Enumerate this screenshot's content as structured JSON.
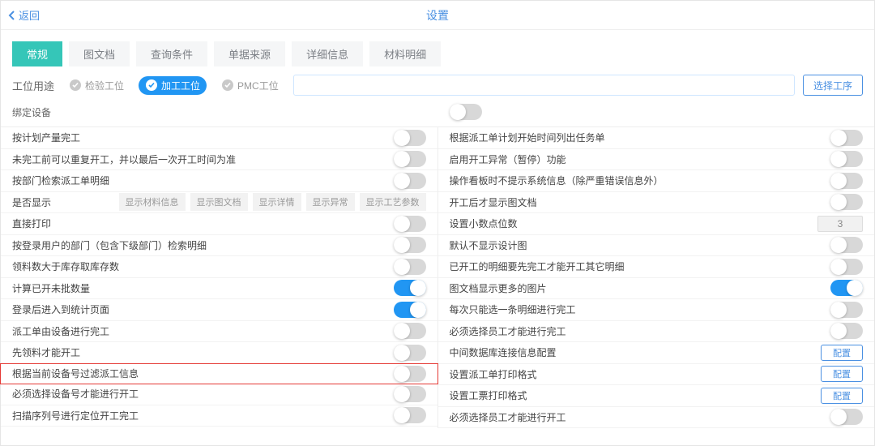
{
  "header": {
    "back": "返回",
    "title": "设置"
  },
  "tabs": [
    "常规",
    "图文档",
    "查询条件",
    "单据来源",
    "详细信息",
    "材料明细"
  ],
  "usage": {
    "label": "工位用途",
    "options": [
      "检验工位",
      "加工工位",
      "PMC工位"
    ],
    "select_process_btn": "选择工序"
  },
  "bind": {
    "label": "绑定设备"
  },
  "btns": {
    "show_material": "显示材料信息",
    "show_drawing": "显示图文档",
    "show_detail": "显示详情",
    "show_exception": "显示异常",
    "show_process_param": "显示工艺参数",
    "config": "配置"
  },
  "decimal_value": "3",
  "left": {
    "r0": "按计划产量完工",
    "r1": "未完工前可以重复开工，并以最后一次开工时间为准",
    "r2": "按部门检索派工单明细",
    "r3": "是否显示",
    "r4": "直接打印",
    "r5": "按登录用户的部门（包含下级部门）检索明细",
    "r6": "领料数大于库存取库存数",
    "r7": "计算已开未批数量",
    "r8": "登录后进入到统计页面",
    "r9": "派工单由设备进行完工",
    "r10": "先领料才能开工",
    "r11": "根据当前设备号过滤派工信息",
    "r12": "必须选择设备号才能进行开工",
    "r13": "扫描序列号进行定位开工完工"
  },
  "right": {
    "r0": "根据派工单计划开始时间列出任务单",
    "r1": "启用开工异常（暂停）功能",
    "r2": "操作看板时不提示系统信息（除严重错误信息外）",
    "r3": "开工后才显示图文档",
    "r4": "设置小数点位数",
    "r5": "默认不显示设计图",
    "r6": "已开工的明细要先完工才能开工其它明细",
    "r7": "图文档显示更多的图片",
    "r8": "每次只能选一条明细进行完工",
    "r9": "必须选择员工才能进行完工",
    "r10": "中间数据库连接信息配置",
    "r11": "设置派工单打印格式",
    "r12": "设置工票打印格式",
    "r13": "必须选择员工才能进行开工"
  }
}
